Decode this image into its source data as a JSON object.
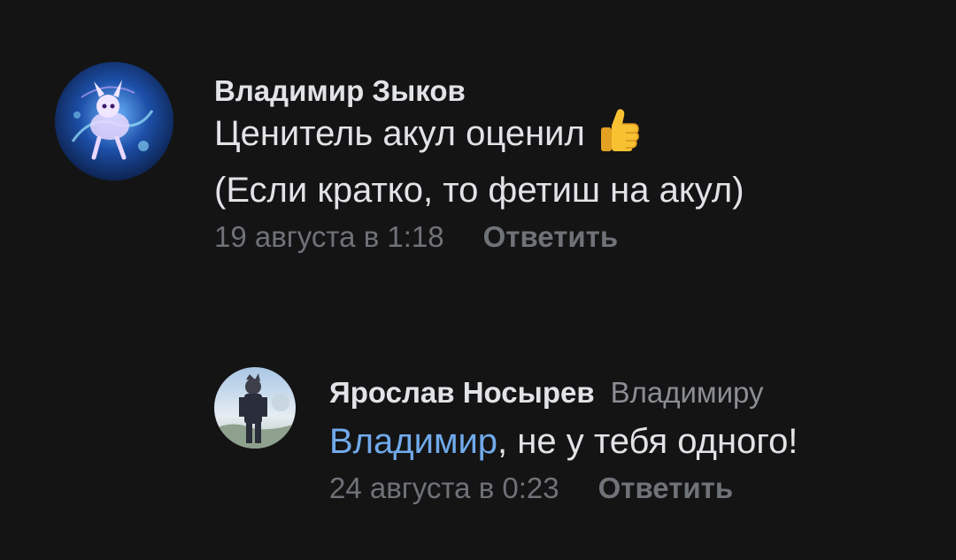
{
  "comments": [
    {
      "author": "Владимир Зыков",
      "text_line1": "Ценитель акул оценил",
      "text_line1_emoji": "thumbs-up-icon",
      "text_line2": "(Если кратко, то фетиш на акул)",
      "date": "19 августа в 1:18",
      "reply_label": "Ответить",
      "avatar_icon": "avatar-blue-creature"
    }
  ],
  "reply": {
    "author": "Ярослав Носырев",
    "reply_to": "Владимиру",
    "mention": "Владимир",
    "text_rest": ", не у тебя одного!",
    "date": "24 августа в 0:23",
    "reply_label": "Ответить",
    "avatar_icon": "avatar-anime-figure"
  },
  "colors": {
    "background": "#141415",
    "text": "#e1e3e6",
    "secondary": "#6f7277",
    "link": "#71aaeb"
  }
}
